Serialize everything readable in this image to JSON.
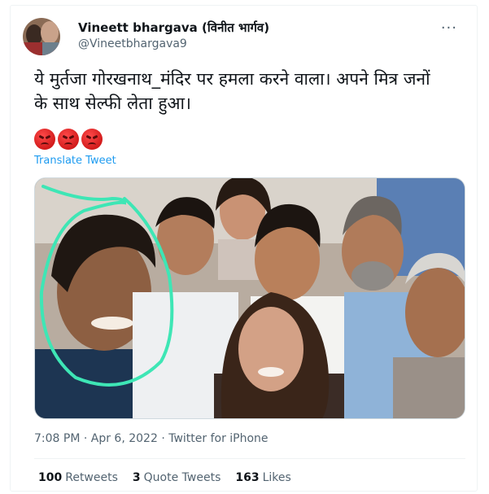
{
  "author": {
    "display_name": "Vineett bhargava (विनीत भार्गव)",
    "handle": "@Vineetbhargava9"
  },
  "more_icon": "more-horizontal-icon",
  "tweet": {
    "text": "ये मुर्तजा गोरखनाथ_मंदिर पर हमला करने वाला। अपने मित्र जनों\nके साथ सेल्फी लेता हुआ।",
    "emojis": [
      "angry-face-icon",
      "angry-face-icon",
      "angry-face-icon"
    ],
    "translate_label": "Translate Tweet"
  },
  "meta": {
    "time": "7:08 PM",
    "date": "Apr 6, 2022",
    "source": "Twitter for iPhone",
    "timestamp_line": "7:08 PM · Apr 6, 2022 · Twitter for iPhone"
  },
  "stats": {
    "retweets_count": "100",
    "retweets_label": "Retweets",
    "quotes_count": "3",
    "quotes_label": "Quote Tweets",
    "likes_count": "163",
    "likes_label": "Likes"
  },
  "colors": {
    "link": "#1d9bf0",
    "secondary_text": "#536471",
    "highlight_circle": "#3ee6b5"
  }
}
